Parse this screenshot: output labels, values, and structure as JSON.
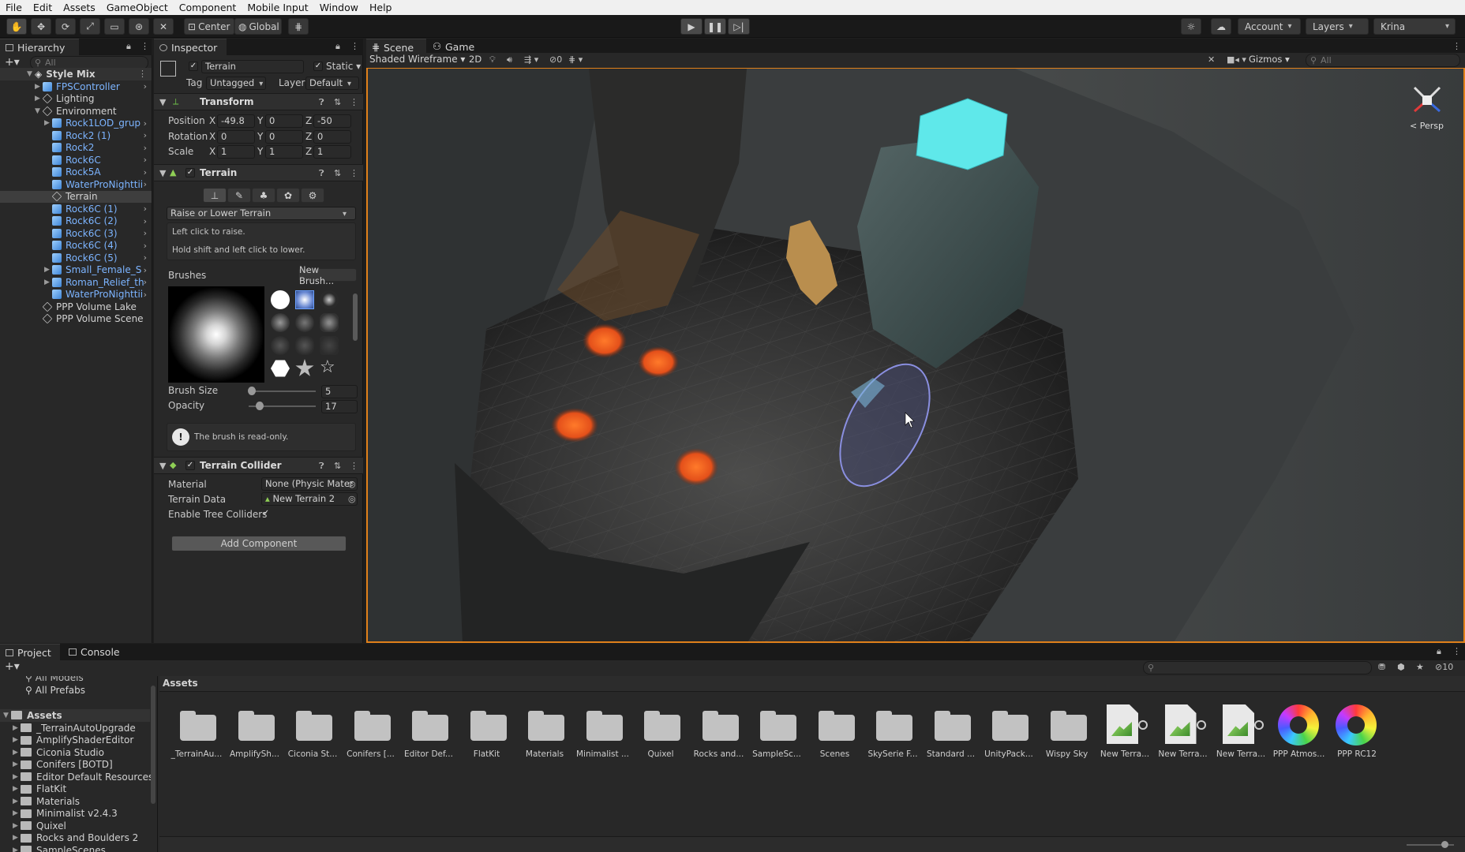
{
  "menu": [
    "File",
    "Edit",
    "Assets",
    "GameObject",
    "Component",
    "Mobile Input",
    "Window",
    "Help"
  ],
  "toolbar": {
    "pivot": "Center",
    "space": "Global",
    "account": "Account",
    "layers": "Layers",
    "layout": "Krina"
  },
  "hierarchy": {
    "tab": "Hierarchy",
    "search_placeholder": "All",
    "scene": "Style Mix",
    "items": [
      {
        "label": "FPSController",
        "indent": 1,
        "blue": true,
        "expand": true,
        "icon": "b"
      },
      {
        "label": "Lighting",
        "indent": 1,
        "blue": false,
        "expand": true,
        "icon": "g"
      },
      {
        "label": "Environment",
        "indent": 1,
        "blue": false,
        "expand": true,
        "open": true,
        "icon": "g"
      },
      {
        "label": "Rock1LOD_grup",
        "indent": 2,
        "blue": true,
        "expand": true,
        "icon": "b"
      },
      {
        "label": "Rock2 (1)",
        "indent": 2,
        "blue": true,
        "icon": "b"
      },
      {
        "label": "Rock2",
        "indent": 2,
        "blue": true,
        "icon": "b"
      },
      {
        "label": "Rock6C",
        "indent": 2,
        "blue": true,
        "icon": "b"
      },
      {
        "label": "Rock5A",
        "indent": 2,
        "blue": true,
        "icon": "b"
      },
      {
        "label": "WaterProNighttii",
        "indent": 2,
        "blue": true,
        "icon": "b"
      },
      {
        "label": "Terrain",
        "indent": 2,
        "blue": false,
        "selected": true,
        "icon": "g"
      },
      {
        "label": "Rock6C (1)",
        "indent": 2,
        "blue": true,
        "icon": "b"
      },
      {
        "label": "Rock6C (2)",
        "indent": 2,
        "blue": true,
        "icon": "b"
      },
      {
        "label": "Rock6C (3)",
        "indent": 2,
        "blue": true,
        "icon": "b"
      },
      {
        "label": "Rock6C (4)",
        "indent": 2,
        "blue": true,
        "icon": "b"
      },
      {
        "label": "Rock6C (5)",
        "indent": 2,
        "blue": true,
        "icon": "b"
      },
      {
        "label": "Small_Female_S",
        "indent": 2,
        "blue": true,
        "expand": true,
        "icon": "b"
      },
      {
        "label": "Roman_Relief_th",
        "indent": 2,
        "blue": true,
        "expand": true,
        "icon": "b"
      },
      {
        "label": "WaterProNighttii",
        "indent": 2,
        "blue": true,
        "icon": "b"
      },
      {
        "label": "PPP Volume Lake",
        "indent": 1,
        "blue": false,
        "icon": "g"
      },
      {
        "label": "PPP Volume Scene",
        "indent": 1,
        "blue": false,
        "icon": "g"
      }
    ]
  },
  "inspector": {
    "tab": "Inspector",
    "object_name": "Terrain",
    "static_label": "Static",
    "tag_label": "Tag",
    "tag_value": "Untagged",
    "layer_label": "Layer",
    "layer_value": "Default",
    "transform": {
      "title": "Transform",
      "position_label": "Position",
      "pos_x": "-49.8",
      "pos_y": "0",
      "pos_z": "-50",
      "rotation_label": "Rotation",
      "rot_x": "0",
      "rot_y": "0",
      "rot_z": "0",
      "scale_label": "Scale",
      "scl_x": "1",
      "scl_y": "1",
      "scl_z": "1",
      "x": "X",
      "y": "Y",
      "z": "Z"
    },
    "terrain": {
      "title": "Terrain",
      "tool": "Raise or Lower Terrain",
      "help_line1": "Left click to raise.",
      "help_line2": "Hold shift and left click to lower.",
      "brushes_label": "Brushes",
      "new_brush": "New Brush...",
      "brush_size_label": "Brush Size",
      "brush_size": "5",
      "opacity_label": "Opacity",
      "opacity": "17",
      "brush_size_fraction": 0.05,
      "opacity_fraction": 0.17,
      "readonly_msg": "The brush is read-only."
    },
    "collider": {
      "title": "Terrain Collider",
      "material_label": "Material",
      "material_value": "None (Physic Mater",
      "terrain_data_label": "Terrain Data",
      "terrain_data_value": "New Terrain 2",
      "tree_label": "Enable Tree Colliders"
    },
    "add_component": "Add Component"
  },
  "scene": {
    "tab_scene": "Scene",
    "tab_game": "Game",
    "draw_mode": "Shaded Wireframe",
    "mode_2d": "2D",
    "fx_count": "0",
    "gizmos": "Gizmos",
    "search_placeholder": "All",
    "persp": "< Persp"
  },
  "project": {
    "tab_project": "Project",
    "tab_console": "Console",
    "all_models": "All Models",
    "all_prefabs": "All Prefabs",
    "assets_root": "Assets",
    "breadcrumb": "Assets",
    "count": "10",
    "tree": [
      "_TerrainAutoUpgrade",
      "AmplifyShaderEditor",
      "Ciconia Studio",
      "Conifers [BOTD]",
      "Editor Default Resources",
      "FlatKit",
      "Materials",
      "Minimalist v2.4.3",
      "Quixel",
      "Rocks and Boulders 2",
      "SampleScenes"
    ],
    "assets": [
      {
        "label": "_TerrainAu...",
        "kind": "folder"
      },
      {
        "label": "AmplifySh...",
        "kind": "folder"
      },
      {
        "label": "Ciconia St...",
        "kind": "folder"
      },
      {
        "label": "Conifers [...",
        "kind": "folder"
      },
      {
        "label": "Editor Def...",
        "kind": "folder"
      },
      {
        "label": "FlatKit",
        "kind": "folder"
      },
      {
        "label": "Materials",
        "kind": "folder"
      },
      {
        "label": "Minimalist ...",
        "kind": "folder"
      },
      {
        "label": "Quixel",
        "kind": "folder"
      },
      {
        "label": "Rocks and...",
        "kind": "folder"
      },
      {
        "label": "SampleSc...",
        "kind": "folder"
      },
      {
        "label": "Scenes",
        "kind": "folder"
      },
      {
        "label": "SkySerie F...",
        "kind": "folder"
      },
      {
        "label": "Standard ...",
        "kind": "folder"
      },
      {
        "label": "UnityPack...",
        "kind": "folder"
      },
      {
        "label": "Wispy Sky",
        "kind": "folder"
      },
      {
        "label": "New Terra...",
        "kind": "terrain"
      },
      {
        "label": "New Terra...",
        "kind": "terrain"
      },
      {
        "label": "New Terra...",
        "kind": "terrain"
      },
      {
        "label": "PPP Atmos...",
        "kind": "ppp"
      },
      {
        "label": "PPP RC12",
        "kind": "ppp"
      }
    ]
  },
  "colors": {
    "accent_orange": "#e0801a",
    "selection_blue": "#2c5d87",
    "prefab_blue": "#7cb4ff"
  }
}
